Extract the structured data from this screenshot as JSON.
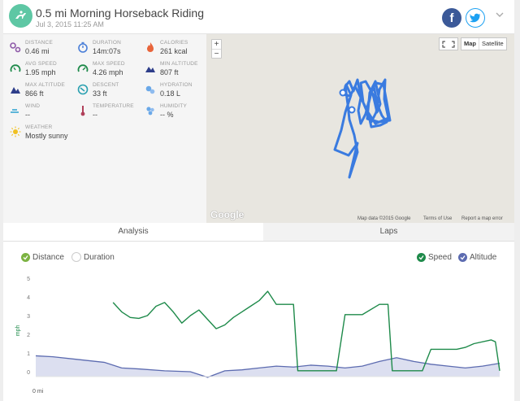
{
  "header": {
    "title": "0.5 mi Morning Horseback Riding",
    "subtitle": "Jul 3, 2015 11:25 AM",
    "facebook_label": "f"
  },
  "stats": [
    {
      "label": "DISTANCE",
      "value": "0.46 mi",
      "icon": "distance-icon",
      "color": "#8e5aa8"
    },
    {
      "label": "DURATION",
      "value": "14m:07s",
      "icon": "duration-icon",
      "color": "#4a7fd8"
    },
    {
      "label": "CALORIES",
      "value": "261 kcal",
      "icon": "calories-icon",
      "color": "#e8643a"
    },
    {
      "label": "AVG SPEED",
      "value": "1.95 mph",
      "icon": "avg-speed-icon",
      "color": "#1e8a4a"
    },
    {
      "label": "MAX SPEED",
      "value": "4.26 mph",
      "icon": "max-speed-icon",
      "color": "#1e8a4a"
    },
    {
      "label": "MIN ALTITUDE",
      "value": "807 ft",
      "icon": "min-altitude-icon",
      "color": "#2e3e8a"
    },
    {
      "label": "MAX ALTITUDE",
      "value": "866 ft",
      "icon": "max-altitude-icon",
      "color": "#2e3e8a"
    },
    {
      "label": "DESCENT",
      "value": "33 ft",
      "icon": "descent-icon",
      "color": "#2aa0b0"
    },
    {
      "label": "HYDRATION",
      "value": "0.18 L",
      "icon": "hydration-icon",
      "color": "#6aa8e8"
    },
    {
      "label": "WIND",
      "value": "--",
      "icon": "wind-icon",
      "color": "#2aa0d0"
    },
    {
      "label": "TEMPERATURE",
      "value": "--",
      "icon": "temperature-icon",
      "color": "#b0405a"
    },
    {
      "label": "HUMIDITY",
      "value": "-- %",
      "icon": "humidity-icon",
      "color": "#6aa8e8"
    },
    {
      "label": "WEATHER",
      "value": "Mostly sunny",
      "icon": "weather-icon",
      "color": "#f0c020"
    }
  ],
  "map": {
    "zoom_in": "+",
    "zoom_out": "−",
    "type_map": "Map",
    "type_satellite": "Satellite",
    "logo": "Google",
    "attribution": "Map data ©2015 Google",
    "terms": "Terms of Use",
    "report": "Report a map error",
    "route_color": "#3a7be0"
  },
  "tabs": [
    {
      "label": "Analysis",
      "active": true
    },
    {
      "label": "Laps",
      "active": false
    }
  ],
  "controls": {
    "distance": {
      "label": "Distance",
      "checked": true,
      "color": "#7cb342"
    },
    "duration": {
      "label": "Duration",
      "checked": false
    },
    "speed": {
      "label": "Speed",
      "checked": true,
      "color": "#1e8a4a"
    },
    "altitude": {
      "label": "Altitude",
      "checked": true,
      "color": "#5c6bb0"
    }
  },
  "chart_data": {
    "type": "line",
    "ylabel": "mph",
    "xlabel": "0 mi",
    "ylim": [
      0,
      5
    ],
    "yticks": [
      "0",
      "1",
      "2",
      "3",
      "4",
      "5"
    ],
    "series": [
      {
        "name": "Speed",
        "color": "#1e8a4a",
        "x": [
          0.09,
          0.1,
          0.11,
          0.12,
          0.13,
          0.14,
          0.15,
          0.16,
          0.17,
          0.18,
          0.19,
          0.2,
          0.21,
          0.22,
          0.23,
          0.24,
          0.25,
          0.26,
          0.27,
          0.28,
          0.29,
          0.3,
          0.305,
          0.31,
          0.312,
          0.32,
          0.33,
          0.35,
          0.36,
          0.37,
          0.38,
          0.4,
          0.41,
          0.415,
          0.44,
          0.45,
          0.46,
          0.49,
          0.5,
          0.51,
          0.53,
          0.535,
          0.54
        ],
        "values": [
          3.7,
          3.2,
          2.9,
          2.85,
          3.0,
          3.5,
          3.7,
          3.2,
          2.6,
          3.0,
          3.3,
          2.8,
          2.3,
          2.5,
          2.9,
          3.2,
          3.5,
          3.8,
          4.3,
          3.6,
          3.6,
          3.6,
          0.05,
          0.05,
          0.05,
          0.05,
          0.05,
          0.05,
          3.05,
          3.05,
          3.05,
          3.6,
          3.6,
          0.05,
          0.05,
          0.05,
          1.2,
          1.2,
          1.3,
          1.5,
          1.7,
          1.6,
          0.05
        ]
      },
      {
        "name": "Altitude",
        "color": "#5c6bb0",
        "x": [
          0.0,
          0.02,
          0.05,
          0.08,
          0.1,
          0.12,
          0.15,
          0.18,
          0.2,
          0.22,
          0.24,
          0.26,
          0.28,
          0.3,
          0.32,
          0.34,
          0.36,
          0.38,
          0.4,
          0.42,
          0.44,
          0.46,
          0.48,
          0.5,
          0.52,
          0.54
        ],
        "values": [
          0.85,
          0.8,
          0.65,
          0.5,
          0.2,
          0.15,
          0.05,
          0.0,
          -0.3,
          0.05,
          0.1,
          0.2,
          0.3,
          0.25,
          0.35,
          0.3,
          0.2,
          0.3,
          0.55,
          0.75,
          0.55,
          0.4,
          0.3,
          0.2,
          0.3,
          0.45
        ]
      }
    ]
  }
}
